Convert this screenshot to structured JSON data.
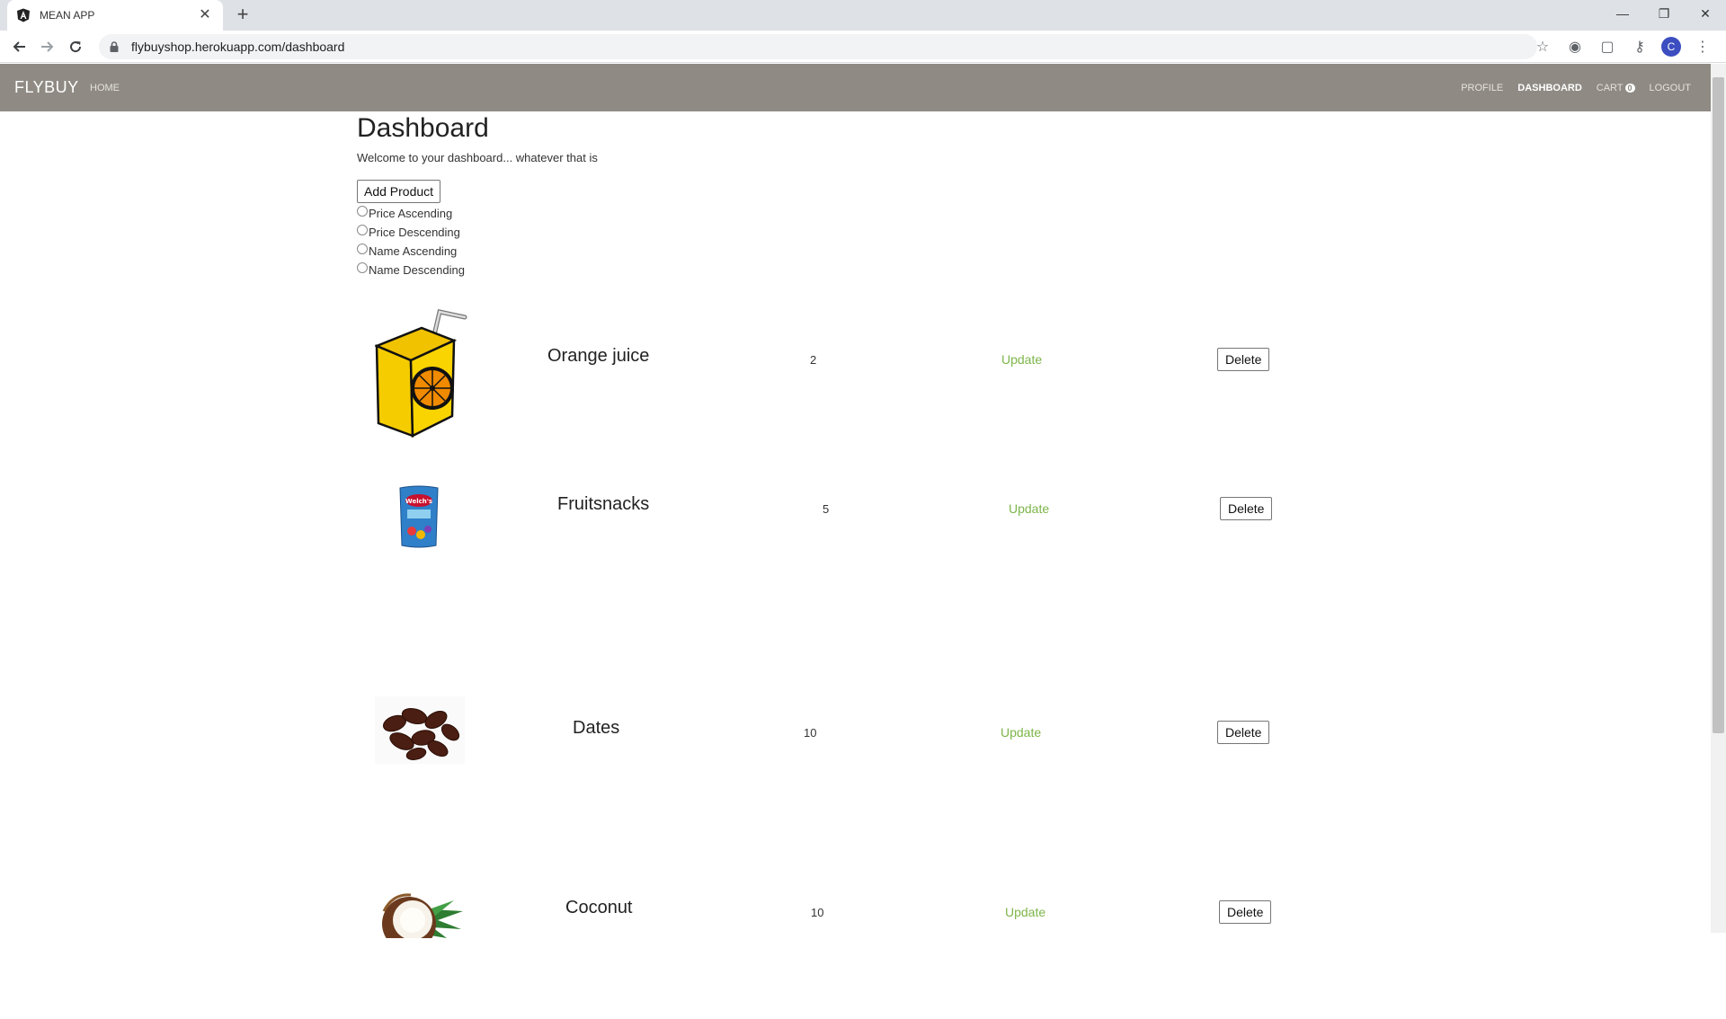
{
  "browser": {
    "tab_title": "MEAN APP",
    "url": "flybuyshop.herokuapp.com/dashboard",
    "avatar_letter": "C"
  },
  "navbar": {
    "brand": "FLYBUY",
    "home": "HOME",
    "profile": "PROFILE",
    "dashboard": "DASHBOARD",
    "cart": "CART",
    "cart_count": "0",
    "logout": "LOGOUT"
  },
  "page": {
    "title": "Dashboard",
    "welcome": "Welcome to your dashboard... whatever that is",
    "add_product": "Add Product",
    "sort_options": [
      "Price Ascending",
      "Price Descending",
      "Name Ascending",
      "Name Descending"
    ]
  },
  "products": [
    {
      "name": "Orange juice",
      "quantity": "2",
      "update": "Update",
      "delete": "Delete"
    },
    {
      "name": "Fruitsnacks",
      "quantity": "5",
      "update": "Update",
      "delete": "Delete"
    },
    {
      "name": "Dates",
      "quantity": "10",
      "update": "Update",
      "delete": "Delete"
    },
    {
      "name": "Coconut",
      "quantity": "10",
      "update": "Update",
      "delete": "Delete"
    }
  ],
  "colors": {
    "navbar_bg": "#8f8b84",
    "update_link": "#7db54a"
  }
}
